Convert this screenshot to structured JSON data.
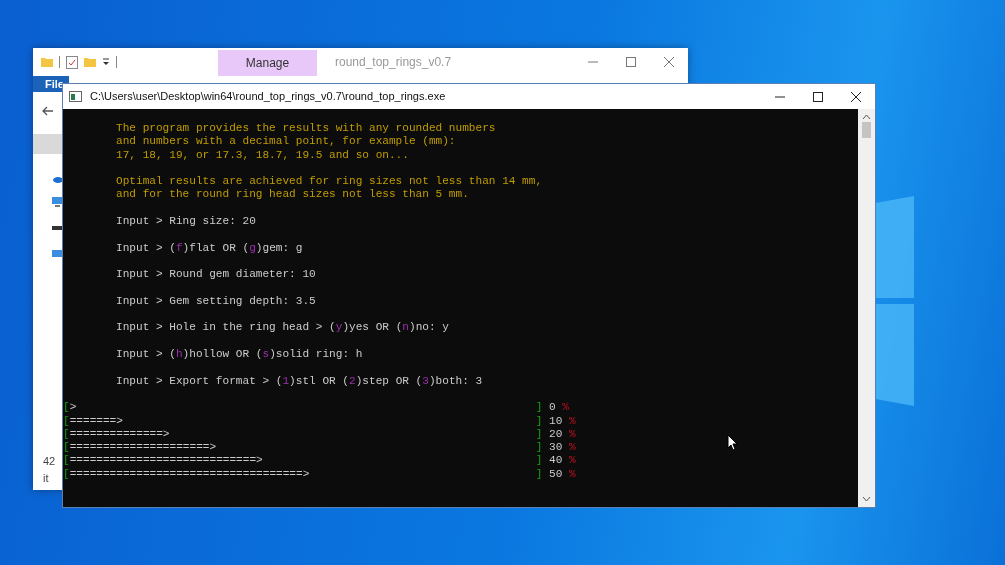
{
  "explorer_window": {
    "title": "round_top_rings_v0.7",
    "context_tab": "Manage",
    "ribbon_tabs": [
      {
        "label": "File",
        "selected": true
      }
    ],
    "status_bar": "42 it"
  },
  "console_window": {
    "title": "C:\\Users\\user\\Desktop\\win64\\round_top_rings_v0.7\\round_top_rings.exe",
    "blocks": [
      {
        "kind": "notice",
        "lines": [
          "The program provides the results with any rounded numbers",
          "and numbers with a decimal point, for example (mm):",
          "17, 18, 19, or 17.3, 18.7, 19.5 and so on..."
        ]
      },
      {
        "kind": "notice",
        "lines": [
          "Optimal results are achieved for ring sizes not less than 14 mm,",
          "and for the round ring head sizes not less than 5 mm."
        ]
      },
      {
        "kind": "input",
        "segments": [
          {
            "kind": "plain",
            "text": "Input > Ring size: 20"
          }
        ]
      },
      {
        "kind": "input",
        "segments": [
          {
            "kind": "plain",
            "text": "Input > ("
          },
          {
            "kind": "key",
            "text": "f"
          },
          {
            "kind": "plain",
            "text": ")flat OR ("
          },
          {
            "kind": "key",
            "text": "g"
          },
          {
            "kind": "plain",
            "text": ")gem: g"
          }
        ]
      },
      {
        "kind": "input",
        "segments": [
          {
            "kind": "plain",
            "text": "Input > Round gem diameter: 10"
          }
        ]
      },
      {
        "kind": "input",
        "segments": [
          {
            "kind": "plain",
            "text": "Input > Gem setting depth: 3.5"
          }
        ]
      },
      {
        "kind": "input",
        "segments": [
          {
            "kind": "plain",
            "text": "Input > Hole in the ring head > ("
          },
          {
            "kind": "key",
            "text": "y"
          },
          {
            "kind": "plain",
            "text": ")yes OR ("
          },
          {
            "kind": "key",
            "text": "n"
          },
          {
            "kind": "plain",
            "text": ")no: y"
          }
        ]
      },
      {
        "kind": "input",
        "segments": [
          {
            "kind": "plain",
            "text": "Input > ("
          },
          {
            "kind": "key",
            "text": "h"
          },
          {
            "kind": "plain",
            "text": ")hollow OR ("
          },
          {
            "kind": "key",
            "text": "s"
          },
          {
            "kind": "plain",
            "text": ")solid ring: h"
          }
        ]
      },
      {
        "kind": "input",
        "segments": [
          {
            "kind": "plain",
            "text": "Input > Export format > ("
          },
          {
            "kind": "key",
            "text": "1"
          },
          {
            "kind": "plain",
            "text": ")stl OR ("
          },
          {
            "kind": "key",
            "text": "2"
          },
          {
            "kind": "plain",
            "text": ")step OR ("
          },
          {
            "kind": "key",
            "text": "3"
          },
          {
            "kind": "plain",
            "text": ")both: 3"
          }
        ]
      },
      {
        "kind": "progress",
        "rows": [
          {
            "open": "[",
            "bar": ">",
            "close": "]",
            "value": "0",
            "unit": "%"
          },
          {
            "open": "[",
            "bar": "=======>",
            "close": "]",
            "value": "10",
            "unit": "%"
          },
          {
            "open": "[",
            "bar": "==============>",
            "close": "]",
            "value": "20",
            "unit": "%"
          },
          {
            "open": "[",
            "bar": "=====================>",
            "close": "]",
            "value": "30",
            "unit": "%"
          },
          {
            "open": "[",
            "bar": "============================>",
            "close": "]",
            "value": "40",
            "unit": "%"
          },
          {
            "open": "[",
            "bar": "===================================>",
            "close": "]",
            "value": "50",
            "unit": "%"
          }
        ]
      }
    ]
  }
}
